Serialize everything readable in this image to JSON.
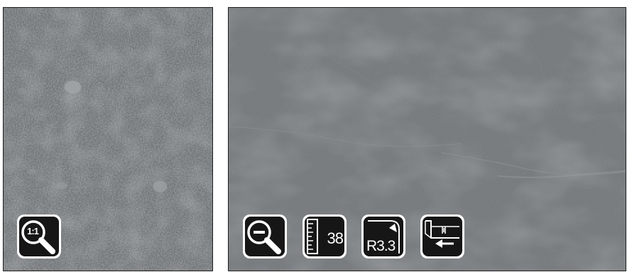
{
  "panels": [
    {
      "id": "left",
      "surface": "fine-grain-gray-stone",
      "base_color": "#6b6f72",
      "icons": [
        {
          "name": "zoom-1to1-icon",
          "label": "1:1"
        }
      ]
    },
    {
      "id": "right",
      "surface": "smooth-gray-stone",
      "base_color": "#74787b",
      "icons": [
        {
          "name": "zoom-out-icon"
        },
        {
          "name": "depth-ruler-icon",
          "value": "38"
        },
        {
          "name": "edge-radius-icon",
          "value": "R3.3"
        },
        {
          "name": "edge-profile-icon"
        }
      ]
    }
  ],
  "colors": {
    "icon_bg": "#161616",
    "icon_border": "#ffffff"
  }
}
